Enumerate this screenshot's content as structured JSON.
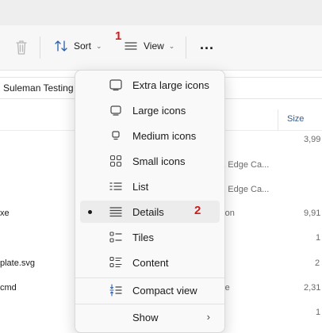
{
  "toolbar": {
    "sort_label": "Sort",
    "view_label": "View",
    "more_label": "...",
    "annotation_1": "1"
  },
  "address": {
    "path_partial": "Suleman Testing F"
  },
  "columns": {
    "size_header": "Size"
  },
  "file_rows": [
    {
      "name": "",
      "type": "e",
      "size": "3,99"
    },
    {
      "name": "",
      "type": "oft Edge Ca...",
      "size": ""
    },
    {
      "name": "",
      "type": "oft Edge Ca...",
      "size": ""
    },
    {
      "name": "xe",
      "type": "ation",
      "size": "9,91"
    },
    {
      "name": "",
      "type": "e",
      "size": "1"
    },
    {
      "name": "plate.svg",
      "type": "",
      "size": "2"
    },
    {
      "name": "cmd",
      "type": "File",
      "size": "2,31"
    },
    {
      "name": "",
      "type": "",
      "size": "1"
    }
  ],
  "view_menu": {
    "items": [
      {
        "label": "Extra large icons",
        "icon": "extra-large-icons-icon"
      },
      {
        "label": "Large icons",
        "icon": "large-icons-icon"
      },
      {
        "label": "Medium icons",
        "icon": "medium-icons-icon"
      },
      {
        "label": "Small icons",
        "icon": "small-icons-icon"
      },
      {
        "label": "List",
        "icon": "list-icon"
      },
      {
        "label": "Details",
        "icon": "details-icon",
        "selected": true
      },
      {
        "label": "Tiles",
        "icon": "tiles-icon"
      },
      {
        "label": "Content",
        "icon": "content-icon"
      },
      {
        "label": "Compact view",
        "icon": "compact-view-icon"
      },
      {
        "label": "Show",
        "icon": "",
        "submenu": true
      }
    ],
    "annotation_2": "2"
  },
  "colors": {
    "annotation": "#d11a1a",
    "accent": "#3a5c8a"
  }
}
